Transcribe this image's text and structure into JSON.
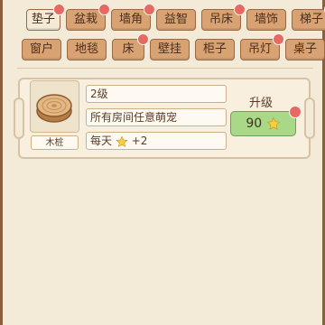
{
  "tabs": [
    {
      "label": "垫子",
      "active": true,
      "badge": true
    },
    {
      "label": "盆栽",
      "active": false,
      "badge": true
    },
    {
      "label": "墙角",
      "active": false,
      "badge": true
    },
    {
      "label": "益智",
      "active": false,
      "badge": false
    },
    {
      "label": "吊床",
      "active": false,
      "badge": true
    },
    {
      "label": "墙饰",
      "active": false,
      "badge": false
    },
    {
      "label": "梯子",
      "active": false,
      "badge": true
    },
    {
      "label": "窗户",
      "active": false,
      "badge": false
    },
    {
      "label": "地毯",
      "active": false,
      "badge": false
    },
    {
      "label": "床",
      "active": false,
      "badge": true
    },
    {
      "label": "壁挂",
      "active": false,
      "badge": false
    },
    {
      "label": "柜子",
      "active": false,
      "badge": false
    },
    {
      "label": "吊灯",
      "active": false,
      "badge": true
    },
    {
      "label": "桌子",
      "active": false,
      "badge": false
    }
  ],
  "item": {
    "name": "木桩",
    "level": "2级",
    "scope": "所有房间任意萌宠",
    "reward_prefix": "每天",
    "reward_value": "+2",
    "icon": "wood-stump-icon"
  },
  "upgrade": {
    "label": "升级",
    "cost": "90",
    "badge": true,
    "accent": "#a9d889"
  },
  "colors": {
    "tab": "#d8a272",
    "badge": "#e46a63",
    "star": "#f7cf3a"
  }
}
